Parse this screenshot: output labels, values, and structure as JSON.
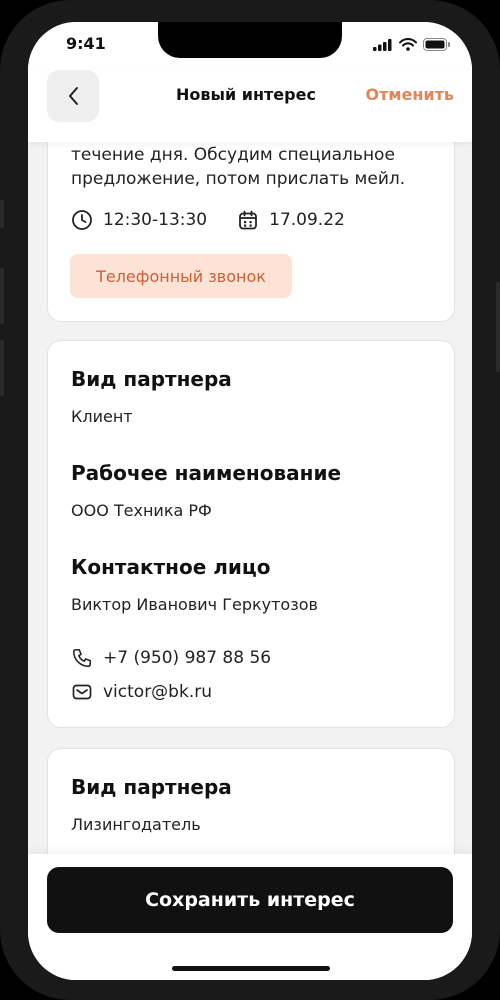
{
  "status_bar": {
    "time": "9:41"
  },
  "nav": {
    "title": "Новый интерес",
    "cancel_label": "Отменить"
  },
  "activity": {
    "description": "течение дня. Обсудим специальное предложение, потом прислать мейл.",
    "time_range": "12:30-13:30",
    "date": "17.09.22",
    "type_tag": "Телефонный звонок"
  },
  "partner_card": {
    "partner_type_label": "Вид партнера",
    "partner_type_value": "Клиент",
    "working_name_label": "Рабочее наименование",
    "working_name_value": "ООО Техника РФ",
    "contact_label": "Контактное лицо",
    "contact_value": "Виктор Иванович Геркутозов",
    "phone": "+7 (950) 987 88 56",
    "email": "victor@bk.ru"
  },
  "partner_card_2": {
    "partner_type_label": "Вид партнера",
    "partner_type_value": "Лизингодатель"
  },
  "footer": {
    "save_label": "Сохранить интерес"
  },
  "colors": {
    "accent": "#e0865a",
    "tag_bg": "#fde3d6",
    "tag_text": "#c8613a",
    "button_bg": "#111111"
  }
}
